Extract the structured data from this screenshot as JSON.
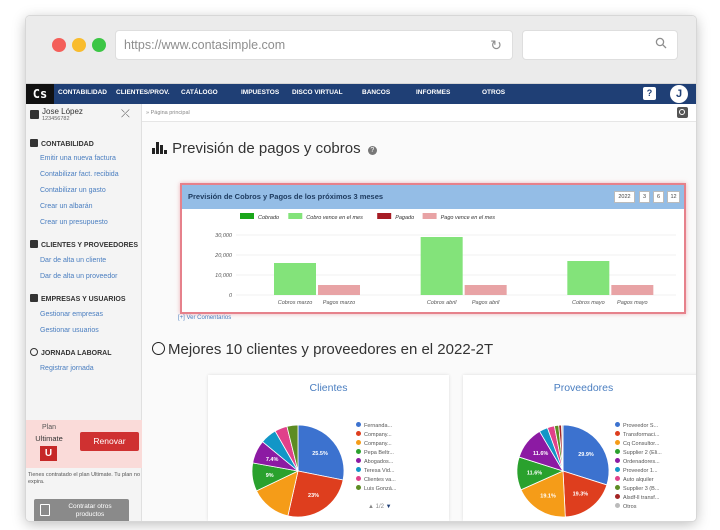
{
  "browser": {
    "url": "https://www.contasimple.com",
    "dots": [
      "#f45f5a",
      "#f9bc2e",
      "#3cc645"
    ]
  },
  "nav": {
    "logo": "Cs",
    "items": [
      "CONTABILIDAD",
      "CLIENTES/PROV.",
      "CATÁLOGO",
      "IMPUESTOS",
      "DISCO VIRTUAL",
      "BANCOS",
      "INFORMES",
      "OTROS"
    ],
    "help": "?",
    "avatar": "J"
  },
  "user": {
    "name": "Jose López",
    "id": "123456782"
  },
  "sidebar": {
    "sections": [
      {
        "title": "CONTABILIDAD",
        "links": [
          "Emitir una nueva factura",
          "Contabilizar fact. recibida",
          "Contabilizar un gasto",
          "Crear un albarán",
          "Crear un presupuesto"
        ]
      },
      {
        "title": "CLIENTES Y PROVEEDORES",
        "links": [
          "Dar de alta un cliente",
          "Dar de alta un proveedor"
        ]
      },
      {
        "title": "EMPRESAS Y USUARIOS",
        "links": [
          "Gestionar empresas",
          "Gestionar usuarios"
        ]
      },
      {
        "title": "JORNADA LABORAL",
        "links": [
          "Registrar jornada"
        ]
      }
    ],
    "plan": {
      "label": "Plan",
      "name": "Ultimate",
      "badge": "U",
      "renew": "Renovar",
      "note": "Tienes contratado el plan Ultimate. Tu plan no expira."
    },
    "more_products": "Contratar otros productos"
  },
  "main": {
    "breadcrumb": "» Página principal",
    "forecast_title": "Previsión de pagos y cobros",
    "panel_title": "Previsión de Cobros y Pagos de los próximos 3 meses",
    "range_buttons": [
      "2022",
      "3",
      "6",
      "12"
    ],
    "comments": "[+] Ver Comentarios",
    "top10_title": "Mejores 10 clientes y proveedores en el 2022-2T",
    "clients_title": "Clientes",
    "providers_title": "Proveedores",
    "clients_pager": "1/2"
  },
  "chart_data": [
    {
      "type": "bar",
      "categories": [
        "Cobros marzo",
        "Pagos marzo",
        "Cobros abril",
        "Pagos abril",
        "Cobros mayo",
        "Pagos mayo"
      ],
      "series": [
        {
          "name": "Cobrado",
          "color": "#1aa61a",
          "values": [
            0,
            0,
            0,
            0,
            0,
            0
          ]
        },
        {
          "name": "Cobro vence en el mes",
          "color": "#83e37a",
          "values": [
            16000,
            0,
            29000,
            0,
            17000,
            0
          ]
        },
        {
          "name": "Pagado",
          "color": "#a61c24",
          "values": [
            0,
            0,
            0,
            0,
            0,
            0
          ]
        },
        {
          "name": "Pago vence en el mes",
          "color": "#e8a3a5",
          "values": [
            0,
            5000,
            0,
            5000,
            0,
            5000
          ]
        }
      ],
      "yticks": [
        "30,000",
        "20,000",
        "10,000",
        "0"
      ],
      "ylim": [
        0,
        30000
      ],
      "legend": "top"
    },
    {
      "type": "pie",
      "title": "Clientes",
      "labels": [
        "Fernanda...",
        "Company...",
        "Company...",
        "Pepa Beltr...",
        "Abogados...",
        "Teresa Vid...",
        "Clientes va...",
        "Luis Gonzá..."
      ],
      "values": [
        25.5,
        23,
        13,
        9,
        7.4,
        5.2,
        4,
        3.5
      ],
      "colors": [
        "#3c72cf",
        "#de3e1e",
        "#f59c18",
        "#2aa12d",
        "#8c1aa3",
        "#1296c7",
        "#e0418a",
        "#5d8c23"
      ],
      "value_labels": [
        "25.5%",
        "23%",
        "",
        "9%",
        "7.4%",
        "",
        "",
        ""
      ]
    },
    {
      "type": "pie",
      "title": "Proveedores",
      "labels": [
        "Proveedor S...",
        "Transformaci...",
        "Cq Consultor...",
        "Supplier 2 (Eli...",
        "Ordenadores...",
        "Proveedor 1...",
        "Auto alquiler",
        "Supplier 3 (B...",
        "Alsdf-ll transf...",
        "Otros"
      ],
      "values": [
        29.9,
        19.3,
        19.1,
        11.6,
        11.6,
        3,
        2.5,
        1.5,
        1,
        0.5
      ],
      "colors": [
        "#3c72cf",
        "#de3e1e",
        "#f59c18",
        "#2aa12d",
        "#8c1aa3",
        "#1296c7",
        "#e0418a",
        "#5d8c23",
        "#a32424",
        "#bbbbbb"
      ],
      "value_labels": [
        "29.9%",
        "19.3%",
        "19.1%",
        "11.6%",
        "11.6%",
        "",
        "",
        "",
        "",
        ""
      ]
    }
  ]
}
